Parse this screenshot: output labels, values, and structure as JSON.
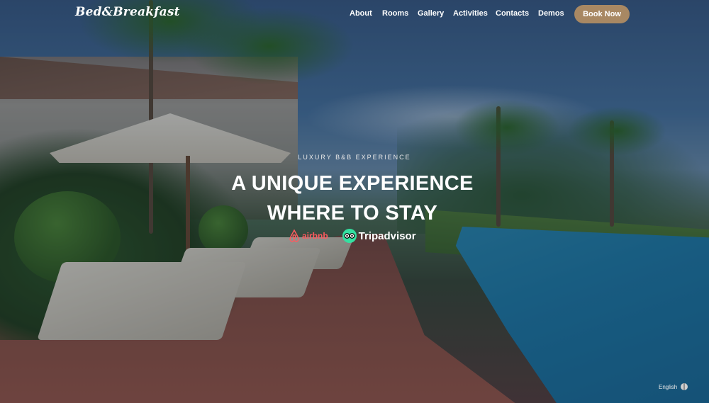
{
  "header": {
    "logo": "Bed&Breakfast",
    "nav": [
      "About",
      "Rooms",
      "Gallery",
      "Activities",
      "Contacts",
      "Demos"
    ],
    "book_now": "Book Now"
  },
  "hero": {
    "kicker": "LUXURY B&B EXPERIENCE",
    "headline_line1": "A UNIQUE EXPERIENCE",
    "headline_line2": "WHERE TO STAY"
  },
  "badges": {
    "airbnb": "airbnb",
    "tripadvisor": "Tripadvisor"
  },
  "footer": {
    "language": "English"
  },
  "colors": {
    "accent": "#a88863",
    "airbnb": "#ff5a5f",
    "tripadvisor": "#34e0a1"
  },
  "icons": [
    "airbnb-logo-icon",
    "tripadvisor-logo-icon",
    "globe-icon"
  ]
}
